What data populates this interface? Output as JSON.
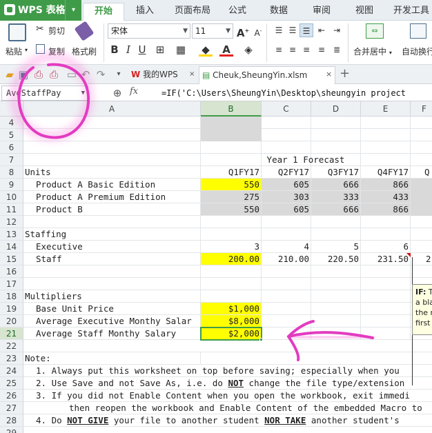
{
  "app": {
    "name": "WPS 表格"
  },
  "menu_tabs": [
    "开始",
    "插入",
    "页面布局",
    "公式",
    "数据",
    "审阅",
    "视图",
    "开发工具"
  ],
  "ribbon": {
    "paste": "粘贴",
    "cut": "剪切",
    "copy": "复制",
    "format_painter": "格式刷",
    "font_name": "宋体",
    "font_size": "11",
    "merge_center": "合并居中",
    "wrap_text": "自动换行"
  },
  "doc_tabs": {
    "home": "我的WPS",
    "file": "Cheuk,SheungYin.xlsm"
  },
  "formula_bar": {
    "name_box": "AvgStaffPay",
    "fx": "fx",
    "formula": "=IF('C:\\Users\\SheungYin\\Desktop\\sheungyin project"
  },
  "columns": [
    "A",
    "B",
    "C",
    "D",
    "E",
    "F"
  ],
  "rows": {
    "r4": "4",
    "r5": "5",
    "r6": "6",
    "r7": "7",
    "r8": "8",
    "r9": "9",
    "r10": "10",
    "r11": "11",
    "r12": "12",
    "r13": "13",
    "r14": "14",
    "r15": "15",
    "r16": "16",
    "r17": "17",
    "r18": "18",
    "r19": "19",
    "r20": "20",
    "r21": "21",
    "r22": "22",
    "r23": "23",
    "r24": "24",
    "r25": "25",
    "r26": "26",
    "r27": "27",
    "r28": "28",
    "r29": "29"
  },
  "sheet": {
    "forecast_title": "Year 1 Forecast",
    "units_label": "Units",
    "quarters": [
      "Q1FY17",
      "Q2FY17",
      "Q3FY17",
      "Q4FY17",
      "Q"
    ],
    "product_a_basic": {
      "label": "Product A Basic Edition",
      "values": [
        "550",
        "605",
        "666",
        "866"
      ]
    },
    "product_a_premium": {
      "label": "Product A Premium Edition",
      "values": [
        "275",
        "303",
        "333",
        "433"
      ]
    },
    "product_b": {
      "label": "Product B",
      "values": [
        "550",
        "605",
        "666",
        "866"
      ]
    },
    "staffing_label": "Staffing",
    "executive": {
      "label": "Executive",
      "values": [
        "3",
        "4",
        "5",
        "6"
      ]
    },
    "staff": {
      "label": "Staff",
      "values": [
        "200.00",
        "210.00",
        "220.50",
        "231.50",
        "2"
      ]
    },
    "multipliers_label": "Multipliers",
    "base_unit_price": {
      "label": "Base Unit Price",
      "value": "$1,000"
    },
    "avg_exec_salary": {
      "label": "Average Executive Monthy Salar",
      "value": "$8,000"
    },
    "avg_staff_salary": {
      "label": "Average Staff Monthy Salary",
      "value": "$2,000"
    },
    "note_label": "Note:",
    "notes": {
      "n1": "1. Always put this worksheet on top before saving; especially when you",
      "n2a": "2. Use Save and not Save As, i.e. do ",
      "n2b": "NOT",
      "n2c": " change the file type/extension",
      "n3": "3. If you did not Enable Content when you open the workbook, exit immedi",
      "n3b": "then reopen the workbook and Enable Content of the embedded Macro to",
      "n4a": "4. Do ",
      "n4b": "NOT GIVE",
      "n4c": " your file to another student ",
      "n4d": "NOR TAKE",
      "n4e": " another student's"
    }
  },
  "tooltip": {
    "title": "IF:",
    "lines": [
      "T",
      "a bla",
      "the r",
      "first"
    ]
  }
}
